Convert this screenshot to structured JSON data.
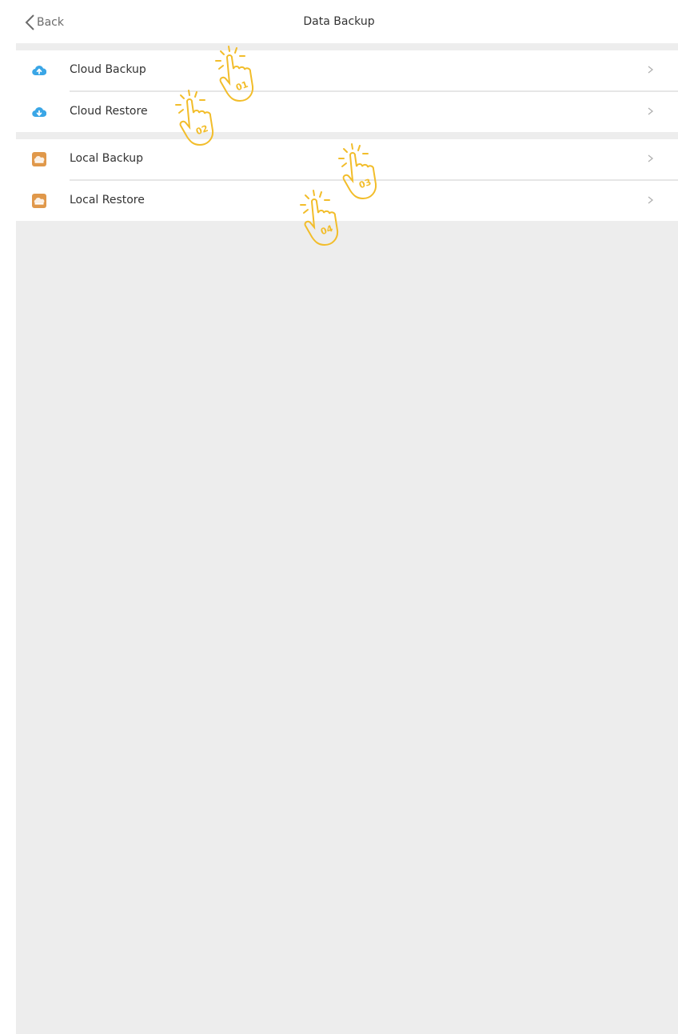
{
  "nav": {
    "back_label": "Back",
    "title": "Data Backup"
  },
  "sections": [
    {
      "items": [
        {
          "label": "Cloud Backup",
          "icon": "cloud-upload-icon",
          "icon_color": "#3aa6e6"
        },
        {
          "label": "Cloud Restore",
          "icon": "cloud-download-icon",
          "icon_color": "#3aa6e6"
        }
      ]
    },
    {
      "items": [
        {
          "label": "Local Backup",
          "icon": "local-storage-icon",
          "icon_color": "#e0984a"
        },
        {
          "label": "Local Restore",
          "icon": "local-storage-icon",
          "icon_color": "#e0984a"
        }
      ]
    }
  ],
  "annotations": [
    "01",
    "02",
    "03",
    "04"
  ],
  "colors": {
    "accent_hand": "#f2bd2a",
    "background": "#ededed",
    "chevron": "#b0b0b0"
  }
}
